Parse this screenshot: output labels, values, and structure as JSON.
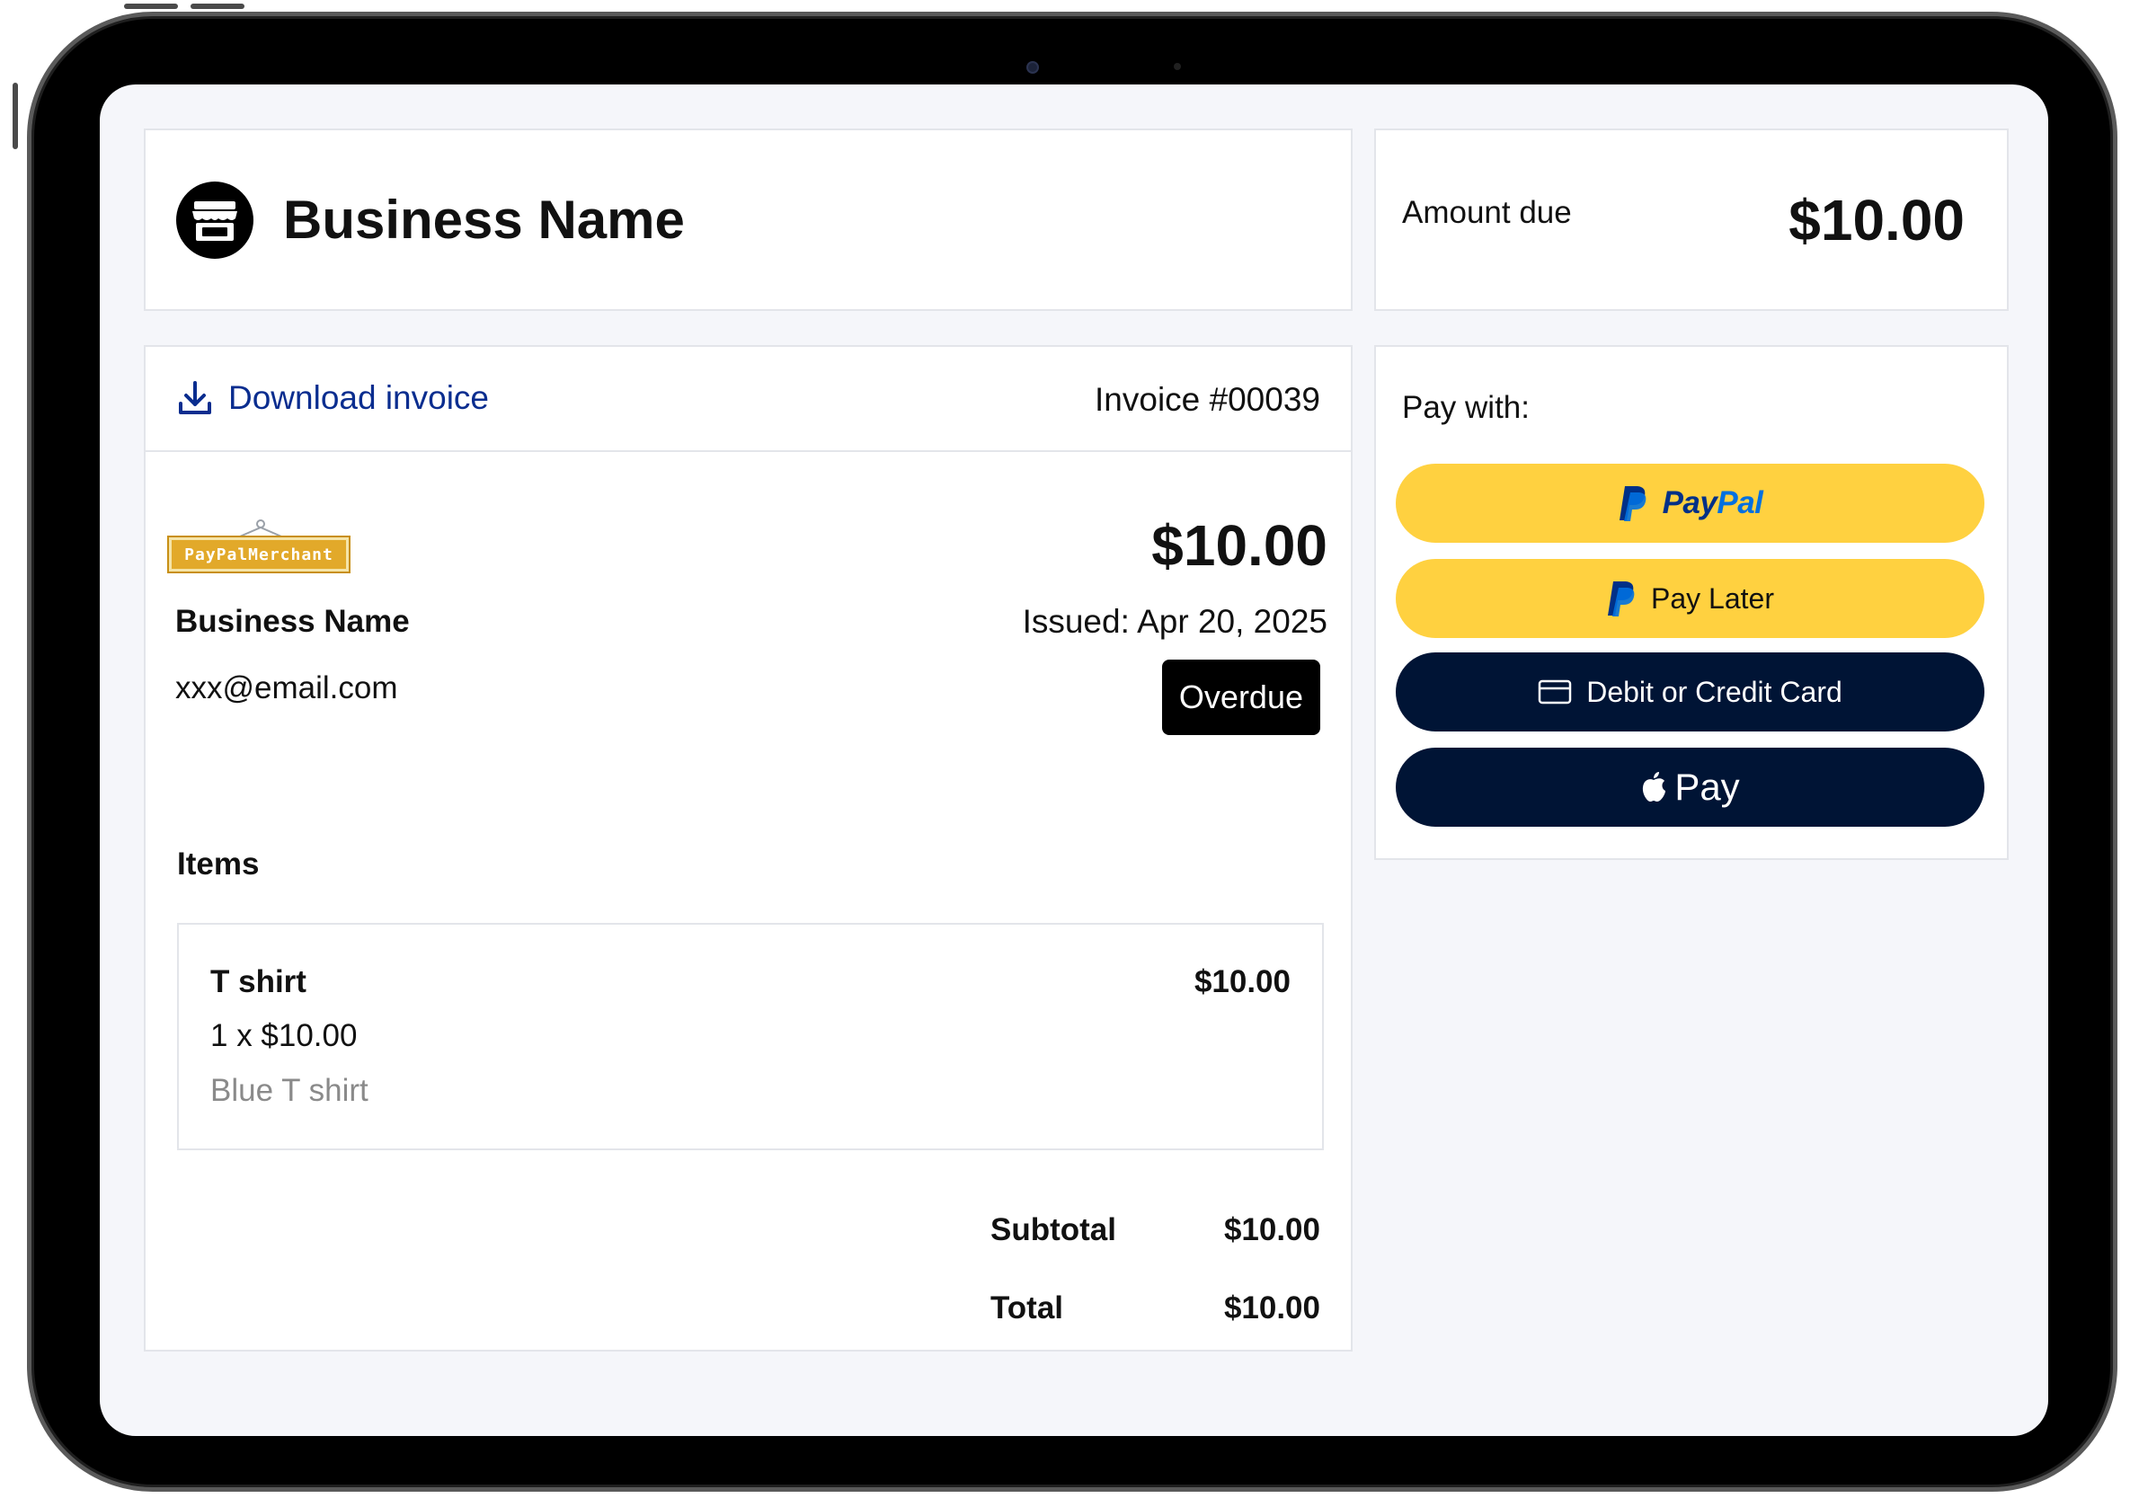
{
  "header": {
    "business_name": "Business Name",
    "store_icon": "storefront-icon"
  },
  "amount_due": {
    "label": "Amount due",
    "value": "$10.00"
  },
  "invoice": {
    "download_label": "Download invoice",
    "download_icon": "download-icon",
    "number": "Invoice #00039",
    "merchant_logo_text": "PayPalMerchant",
    "merchant_name": "Business Name",
    "merchant_email": "xxx@email.com",
    "amount": "$10.00",
    "issued": "Issued: Apr 20, 2025",
    "status": "Overdue",
    "status_color": "#000000"
  },
  "items": {
    "heading": "Items",
    "list": [
      {
        "name": "T shirt",
        "quantity_price": "1 x $10.00",
        "description": "Blue T shirt",
        "total": "$10.00"
      }
    ]
  },
  "summary": {
    "subtotal_label": "Subtotal",
    "subtotal_value": "$10.00",
    "total_label": "Total",
    "total_value": "$10.00"
  },
  "payment": {
    "title": "Pay with:",
    "paypal_word_pay": "Pay",
    "paypal_word_pal": "Pal",
    "pay_later_label": "Pay Later",
    "card_label": "Debit or Credit Card",
    "apple_pay_label": "Pay",
    "colors": {
      "paypal_yellow": "#ffd140",
      "navy": "#001435",
      "paypal_blue_dark": "#003087",
      "paypal_blue_light": "#0070e0",
      "link_blue": "#0a2d8f"
    }
  }
}
